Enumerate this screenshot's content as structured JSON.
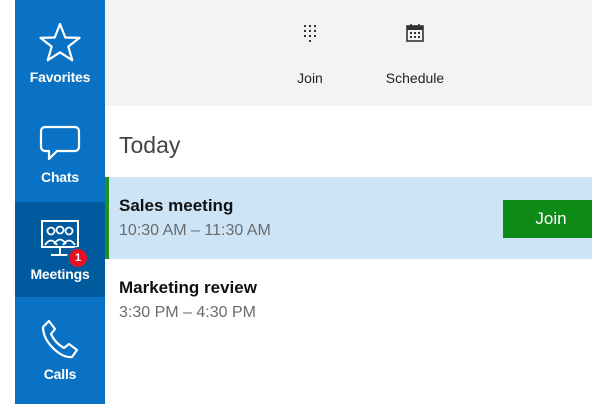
{
  "nav": {
    "items": [
      {
        "label": "Favorites",
        "icon": "star-icon"
      },
      {
        "label": "Chats",
        "icon": "chat-bubble-icon"
      },
      {
        "label": "Meetings",
        "icon": "meetings-icon",
        "badge": "1",
        "selected": true
      },
      {
        "label": "Calls",
        "icon": "phone-icon"
      }
    ]
  },
  "toolbar": {
    "join_label": "Join",
    "join_icon": "dialpad-icon",
    "schedule_label": "Schedule",
    "schedule_icon": "calendar-icon"
  },
  "main": {
    "section_title": "Today",
    "meetings": [
      {
        "title": "Sales meeting",
        "time": "10:30 AM – 11:30 AM",
        "action": "Join",
        "active": true
      },
      {
        "title": "Marketing review",
        "time": "3:30 PM – 4:30 PM"
      }
    ]
  },
  "colors": {
    "rail": "#0a72c4",
    "rail_selected": "#005a9e",
    "active_row": "#cce4f6",
    "join_button": "#0e8a16",
    "badge": "#e81123"
  }
}
